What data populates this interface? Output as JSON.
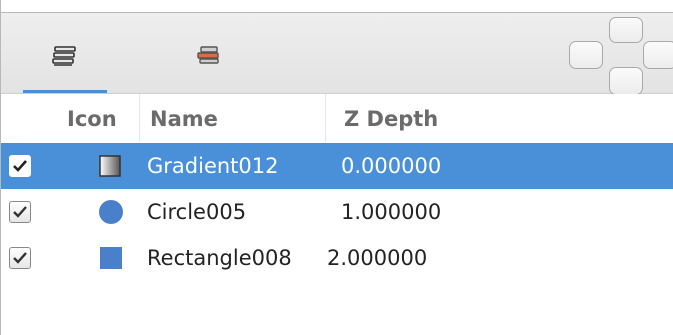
{
  "tabs": [
    {
      "name": "layers-tab-icon",
      "active": true
    },
    {
      "name": "library-tab-icon",
      "active": false
    }
  ],
  "columns": {
    "icon": "Icon",
    "name": "Name",
    "z_depth": "Z Depth"
  },
  "rows": [
    {
      "checked": true,
      "icon": "gradient-icon",
      "name": "Gradient012",
      "z": "0.000000",
      "selected": true
    },
    {
      "checked": true,
      "icon": "circle-icon",
      "name": "Circle005",
      "z": "1.000000",
      "selected": false
    },
    {
      "checked": true,
      "icon": "rectangle-icon",
      "name": "Rectangle008",
      "z": "2.000000",
      "selected": false
    }
  ],
  "colors": {
    "selection": "#4a90d9",
    "shape_fill": "#4a80c9"
  }
}
